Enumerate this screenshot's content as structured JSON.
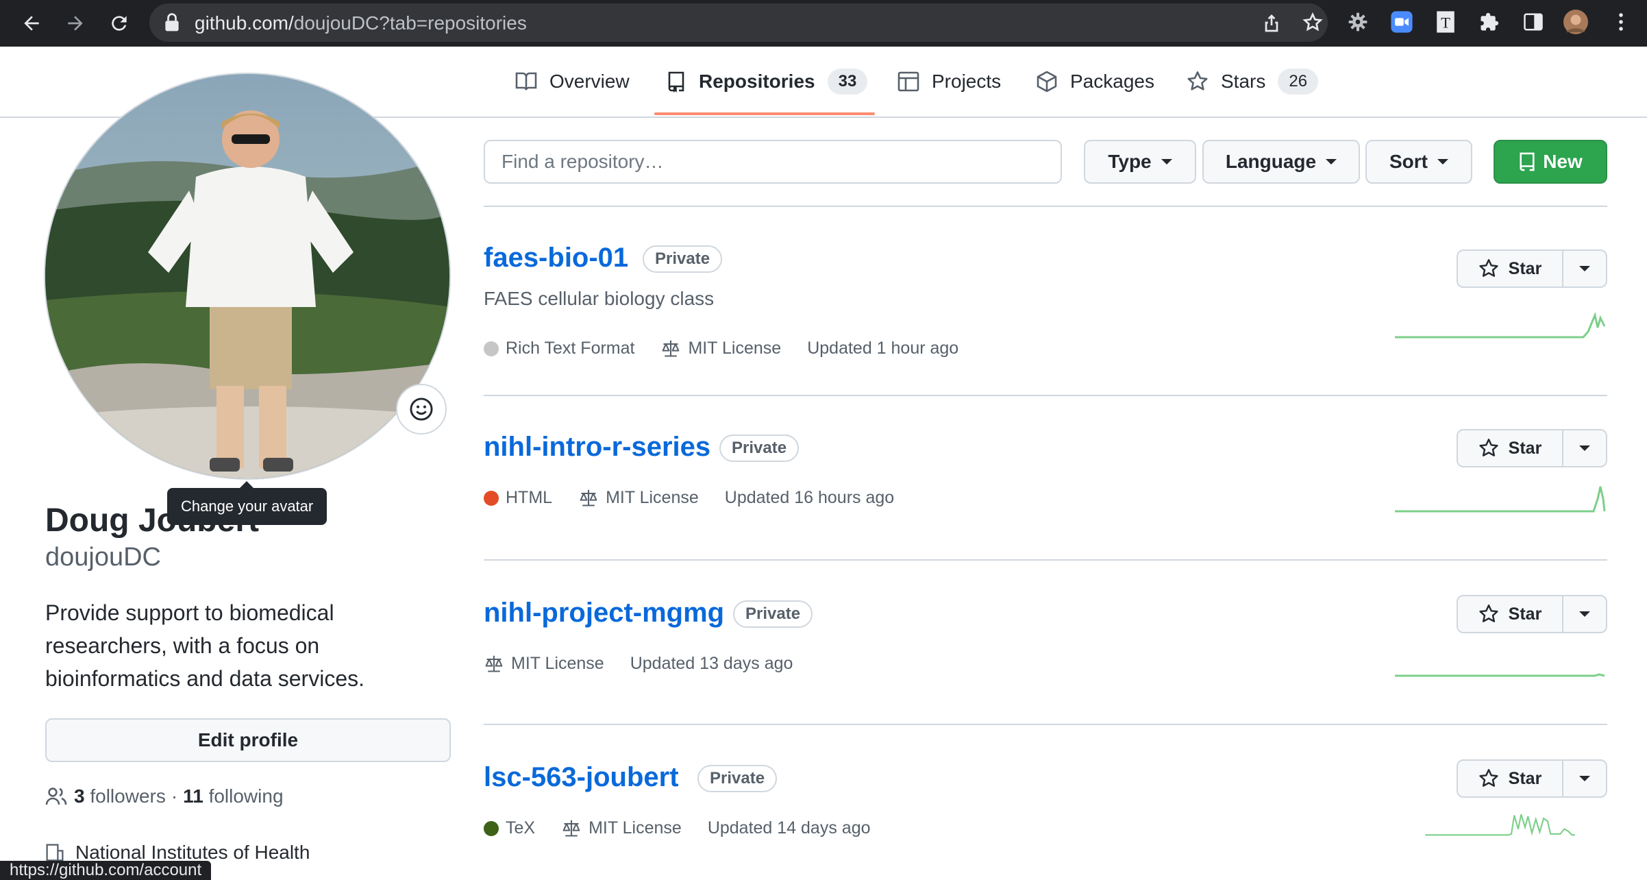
{
  "browser": {
    "url_domain": "github.com/",
    "url_path": "doujouDC?tab=repositories",
    "status_url": "https://github.com/account"
  },
  "nav": {
    "tabs": [
      {
        "label": "Overview",
        "icon": "book-icon"
      },
      {
        "label": "Repositories",
        "count": "33",
        "icon": "repo-icon",
        "selected": true
      },
      {
        "label": "Projects",
        "icon": "table-icon"
      },
      {
        "label": "Packages",
        "icon": "package-icon"
      },
      {
        "label": "Stars",
        "count": "26",
        "icon": "star-icon"
      }
    ]
  },
  "profile": {
    "name": "Doug Joubert",
    "login": "doujouDC",
    "tooltip": "Change your avatar",
    "bio": "Provide support to biomedical researchers, with a focus on bioinformatics and data services.",
    "edit_label": "Edit profile",
    "followers_count": "3",
    "followers_label": "followers",
    "separator": "·",
    "following_count": "11",
    "following_label": "following",
    "organization": "National Institutes of Health"
  },
  "filters": {
    "search_placeholder": "Find a repository…",
    "type_label": "Type",
    "language_label": "Language",
    "sort_label": "Sort",
    "new_label": "New"
  },
  "repos": [
    {
      "name": "faes-bio-01",
      "visibility": "Private",
      "description": "FAES cellular biology class",
      "language": "Rich Text Format",
      "language_color": "#c6c6c6",
      "license": "MIT License",
      "updated": "Updated 1 hour ago",
      "star_label": "Star"
    },
    {
      "name": "nihl-intro-r-series",
      "visibility": "Private",
      "description": "",
      "language": "HTML",
      "language_color": "#e34c26",
      "license": "MIT License",
      "updated": "Updated 16 hours ago",
      "star_label": "Star"
    },
    {
      "name": "nihl-project-mgmg",
      "visibility": "Private",
      "description": "",
      "language": "",
      "language_color": "",
      "license": "MIT License",
      "updated": "Updated 13 days ago",
      "star_label": "Star"
    },
    {
      "name": "lsc-563-joubert",
      "visibility": "Private",
      "description": "",
      "language": "TeX",
      "language_color": "#3d6117",
      "license": "MIT License",
      "updated": "Updated 14 days ago",
      "star_label": "Star"
    }
  ],
  "colors": {
    "accent_blue": "#0969da",
    "new_green": "#2da44e",
    "tab_underline": "#fd8c73",
    "sparkline": "#7ccf8a"
  }
}
